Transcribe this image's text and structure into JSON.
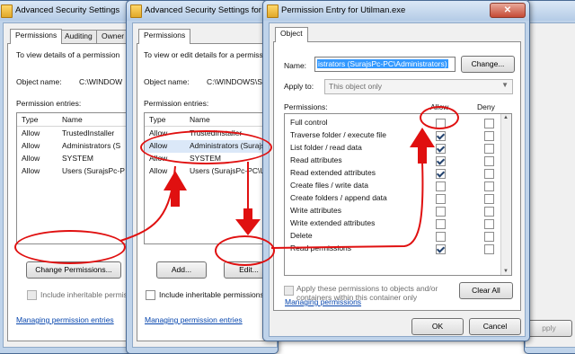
{
  "win1": {
    "title": "Advanced Security Settings",
    "tabs": [
      "Permissions",
      "Auditing",
      "Owner"
    ],
    "intro": "To view details of a permission",
    "object_label": "Object name:",
    "object_value": "C:\\WINDOW",
    "entries_label": "Permission entries:",
    "columns": [
      "Type",
      "Name"
    ],
    "rows": [
      {
        "type": "Allow",
        "name": "TrustedInstaller"
      },
      {
        "type": "Allow",
        "name": "Administrators (S"
      },
      {
        "type": "Allow",
        "name": "SYSTEM"
      },
      {
        "type": "Allow",
        "name": "Users (SurajsPc-P"
      }
    ],
    "change_button": "Change Permissions...",
    "inherit_label": "Include inheritable permissions",
    "manage_link": "Managing permission entries"
  },
  "win2": {
    "title": "Advanced Security Settings for",
    "tabs": [
      "Permissions"
    ],
    "intro": "To view or edit details for a permissi",
    "object_label": "Object name:",
    "object_value": "C:\\WINDOWS\\S",
    "entries_label": "Permission entries:",
    "columns": [
      "Type",
      "Name"
    ],
    "rows": [
      {
        "type": "Allow",
        "name": "TrustedInstaller"
      },
      {
        "type": "Allow",
        "name": "Administrators (Surajs"
      },
      {
        "type": "Allow",
        "name": "SYSTEM"
      },
      {
        "type": "Allow",
        "name": "Users (SurajsPc-PC\\U"
      }
    ],
    "add_button": "Add...",
    "edit_button": "Edit...",
    "inherit_label": "Include inheritable permissions fro",
    "manage_link": "Managing permission entries"
  },
  "win3": {
    "title": "Permission Entry for Utilman.exe",
    "tab": "Object",
    "name_label": "Name:",
    "name_value": "istrators (SurajsPc-PC\\Administrators)",
    "change_button": "Change...",
    "apply_label": "Apply to:",
    "apply_value": "This object only",
    "perm_label": "Permissions:",
    "allow_label": "Allow",
    "deny_label": "Deny",
    "permissions": [
      {
        "label": "Full control",
        "allow": false,
        "deny": false
      },
      {
        "label": "Traverse folder / execute file",
        "allow": true,
        "deny": false
      },
      {
        "label": "List folder / read data",
        "allow": true,
        "deny": false
      },
      {
        "label": "Read attributes",
        "allow": true,
        "deny": false
      },
      {
        "label": "Read extended attributes",
        "allow": true,
        "deny": false
      },
      {
        "label": "Create files / write data",
        "allow": false,
        "deny": false
      },
      {
        "label": "Create folders / append data",
        "allow": false,
        "deny": false
      },
      {
        "label": "Write attributes",
        "allow": false,
        "deny": false
      },
      {
        "label": "Write extended attributes",
        "allow": false,
        "deny": false
      },
      {
        "label": "Delete",
        "allow": false,
        "deny": false
      },
      {
        "label": "Read permissions",
        "allow": true,
        "deny": false
      }
    ],
    "apply_children": "Apply these permissions to objects and/or containers within this container only",
    "clear_all": "Clear All",
    "manage_link": "Managing permissions",
    "ok": "OK",
    "cancel": "Cancel"
  },
  "behind": {
    "apply_fragment": "pply"
  },
  "colors": {
    "annotation": "#e01010",
    "titlebar": "#bfd3ea",
    "link": "#0645ad"
  }
}
